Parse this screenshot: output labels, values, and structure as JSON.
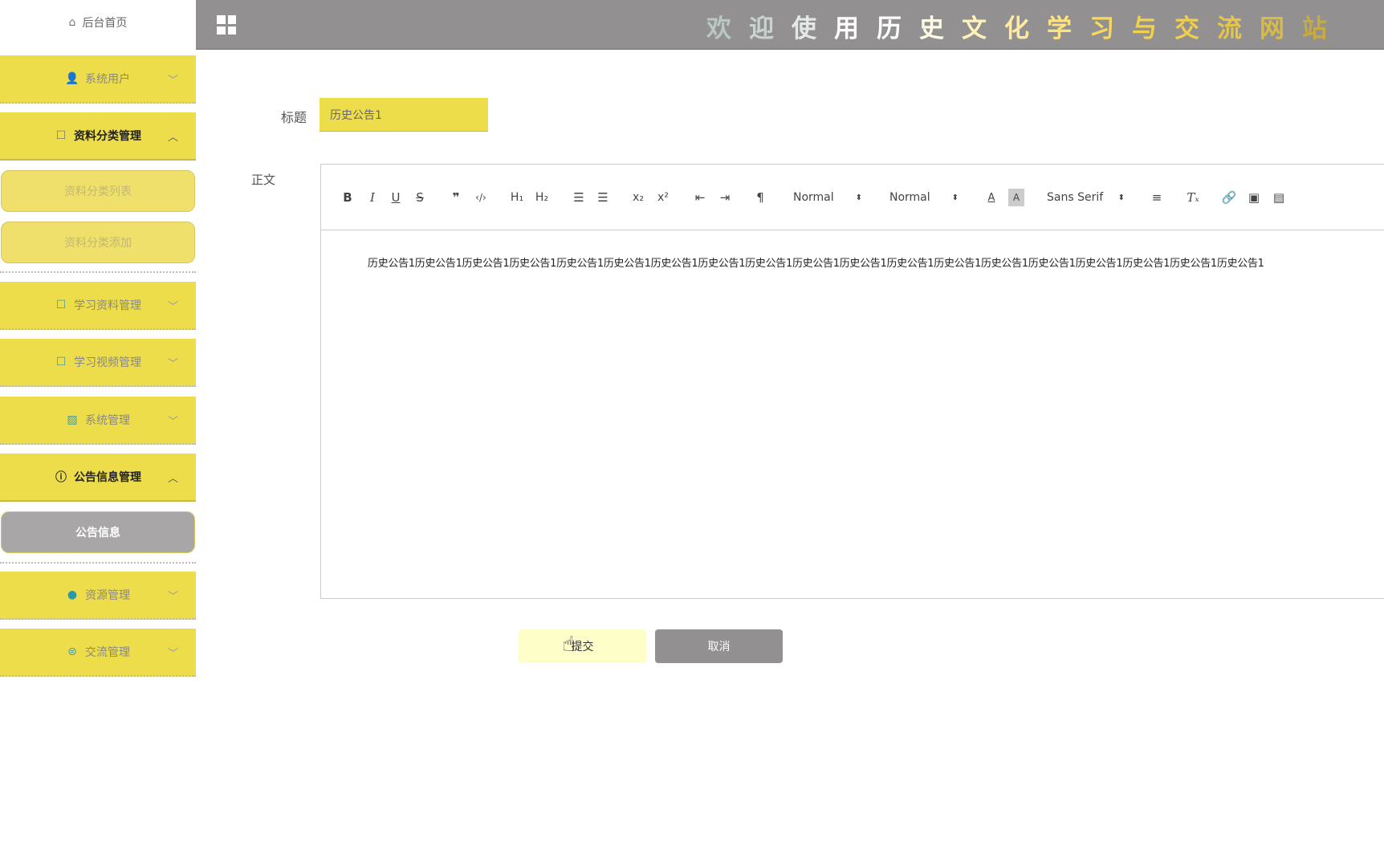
{
  "sidebar": {
    "home": {
      "label": "后台首页",
      "icon": "home-icon"
    },
    "menus": [
      {
        "label": "系统用户",
        "icon": "user-icon",
        "expanded": false
      },
      {
        "label": "资料分类管理",
        "icon": "note-icon",
        "expanded": true,
        "children": [
          "资料分类列表",
          "资料分类添加"
        ]
      },
      {
        "label": "学习资料管理",
        "icon": "note-icon",
        "expanded": false
      },
      {
        "label": "学习视频管理",
        "icon": "note-icon",
        "expanded": false
      },
      {
        "label": "系统管理",
        "icon": "image-icon",
        "expanded": false
      },
      {
        "label": "公告信息管理",
        "icon": "info-icon",
        "expanded": true,
        "children": [
          "公告信息"
        ]
      },
      {
        "label": "资源管理",
        "icon": "bulb-icon",
        "expanded": false
      },
      {
        "label": "交流管理",
        "icon": "chat-icon",
        "expanded": false
      }
    ]
  },
  "header": {
    "title": [
      "欢",
      "迎",
      "使",
      "用",
      "历",
      "史",
      "文",
      "化",
      "学",
      "习",
      "与",
      "交",
      "流",
      "网",
      "站"
    ],
    "title_colors": [
      "#b9c7c4",
      "#c9d3d0",
      "#e4e8e6",
      "#ffffff",
      "#ffffff",
      "#fffbe6",
      "#fff2b8",
      "#ffeaa0",
      "#fde47e",
      "#f7d85a",
      "#f2d24a",
      "#efcf4d",
      "#e5c64a",
      "#d8bb48",
      "#c6ab45"
    ]
  },
  "form": {
    "title_label": "标题",
    "title_value": "历史公告1",
    "body_label": "正文",
    "toolbar": {
      "header_select": "Normal",
      "size_select": "Normal",
      "font_select": "Sans Serif"
    },
    "body_text": "历史公告1历史公告1历史公告1历史公告1历史公告1历史公告1历史公告1历史公告1历史公告1历史公告1历史公告1历史公告1历史公告1历史公告1历史公告1历史公告1历史公告1历史公告1历史公告1",
    "submit_label": "提交",
    "cancel_label": "取消"
  },
  "colors": {
    "menu_bg": "#eedd4a",
    "header_bg": "#929090",
    "active_sub": "#a8a6a6",
    "submit_bg": "#fefec8"
  }
}
